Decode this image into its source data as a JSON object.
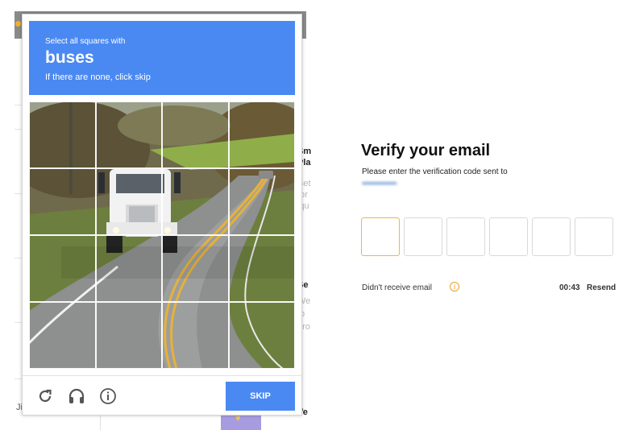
{
  "background_page": {
    "side_fragments_top": [
      "Sm",
      "Pla",
      "Bet",
      "for",
      "lqu"
    ],
    "side_fragments_bottom": [
      "Se",
      "We",
      "to",
      "oro"
    ],
    "bottom_fragment": "Ve",
    "left_fragment": "Ji"
  },
  "captcha": {
    "instruction_prefix": "Select all squares with",
    "target_object": "buses",
    "instruction_hint": "If there are none, click skip",
    "grid_rows": 4,
    "grid_cols": 4,
    "skip_label": "SKIP",
    "header_color": "#4a89f2",
    "icons": [
      "reload-icon",
      "audio-headphones-icon",
      "info-icon"
    ]
  },
  "verify": {
    "title": "Verify your email",
    "subtitle": "Please enter the verification code sent to",
    "email_redacted": "•••••••••••••••••",
    "code_boxes": 6,
    "didnt_receive": "Didn't receive email",
    "timer": "00:43",
    "resend_label": "Resend",
    "accent_color": "#e8b74a"
  }
}
